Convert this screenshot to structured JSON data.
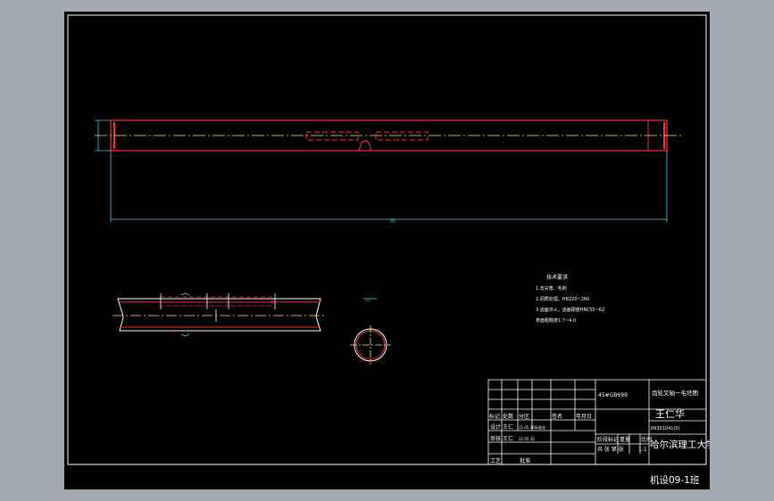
{
  "drawing": {
    "notes": {
      "heading": "技术要求",
      "lines": [
        "1.去尖角、毛刺",
        "2.调质处理，HB220~260",
        "3.齿面淬火，齿面硬度HRC55~62",
        "  表面粗糙度1.7~4.0"
      ]
    },
    "dimension_label": "m",
    "key_label": "▭"
  },
  "title_block": {
    "material": "45#GB699",
    "drawing_name": "齿轮叉轴一毛坯图",
    "designer_name": "王仁华",
    "drawing_number": "09301041(0)",
    "stage_label": "阶段标记",
    "weight_label": "重量",
    "scale_label": "比例",
    "scale_value": "1:1",
    "school": "哈尔滨理工大学",
    "class": "机设09-1班",
    "row_labels": [
      "标记",
      "处数",
      "分区",
      "更改文件号",
      "签名",
      "年月日"
    ],
    "roles": [
      "设计",
      "审核",
      "工艺"
    ],
    "person": "王仁",
    "date_small": "11.05.10",
    "std": "标准化",
    "approve": "批准",
    "sheet_label": "共  张 第  张"
  }
}
